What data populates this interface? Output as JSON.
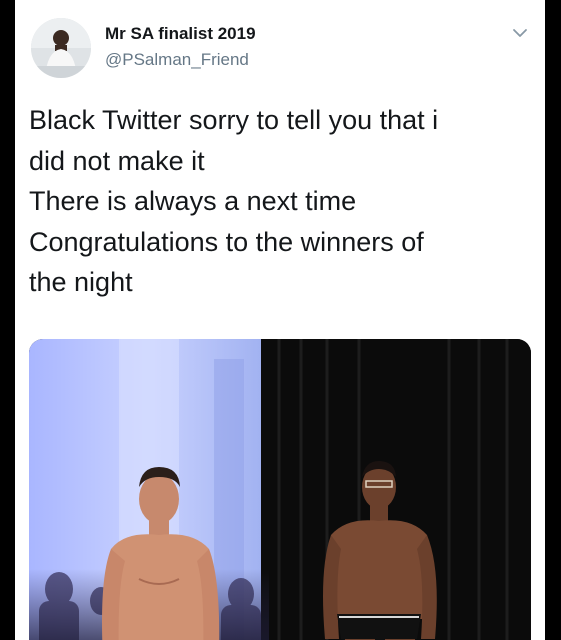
{
  "tweet": {
    "display_name": "Mr SA finalist 2019",
    "handle": "@PSalman_Friend",
    "text_lines": [
      "Black Twitter sorry to tell you that i",
      "did not make it",
      "There is always a next time",
      "Congratulations to the winners of",
      "the night"
    ],
    "menu_icon": "chevron-down-icon"
  },
  "colors": {
    "background": "#000000",
    "card": "#ffffff",
    "text_primary": "#14171a",
    "text_secondary": "#657786",
    "stage_left": "#bcc8ff",
    "stage_right_curtain": "#0b0b0b"
  }
}
